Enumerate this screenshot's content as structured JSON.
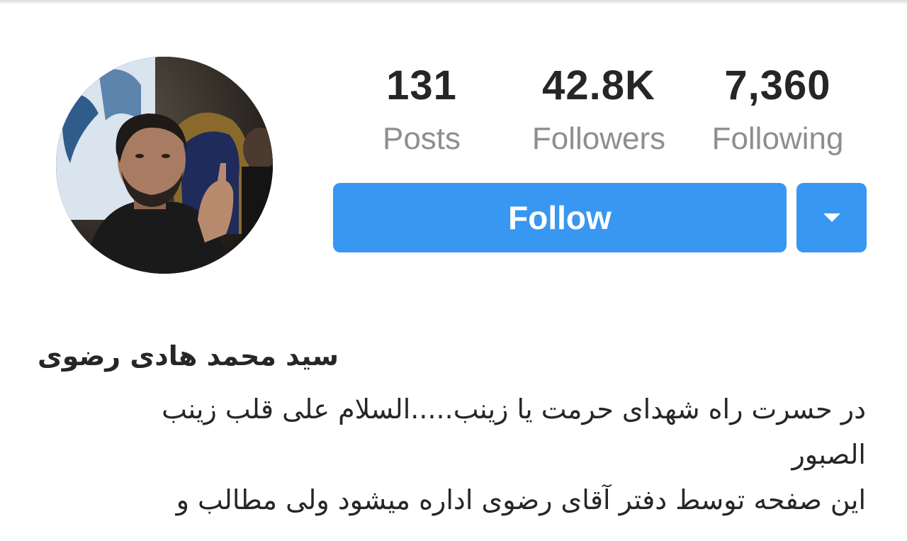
{
  "profile": {
    "display_name": "سید محمد هادی رضوی",
    "bio_lines": [
      "در حسرت راه شهدای حرمت یا زینب.....السلام علی قلب زینب",
      "الصبور",
      "این صفحه توسط دفتر آقای رضوی اداره میشود ولی مطالب و"
    ]
  },
  "stats": {
    "posts": {
      "value": "131",
      "label": "Posts"
    },
    "followers": {
      "value": "42.8K",
      "label": "Followers"
    },
    "following": {
      "value": "7,360",
      "label": "Following"
    }
  },
  "actions": {
    "follow_label": "Follow",
    "dropdown_icon": "chevron-down-icon"
  },
  "colors": {
    "accent": "#3897f0",
    "text_primary": "#262626",
    "text_secondary": "#8e8e8e"
  }
}
